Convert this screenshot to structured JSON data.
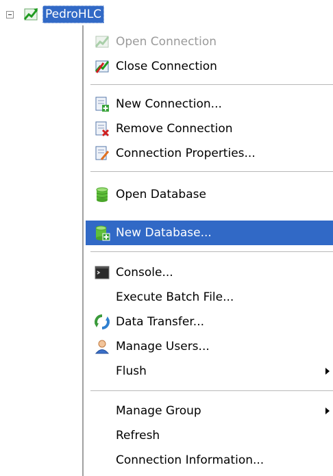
{
  "tree": {
    "node_label": "PedroHLC",
    "icons": {
      "expander": "collapse-minus",
      "connection": "connection-chart-icon"
    }
  },
  "menu": {
    "items": [
      {
        "label": "Open Connection",
        "icon": "open-connection-icon",
        "disabled": true
      },
      {
        "label": "Close Connection",
        "icon": "close-connection-icon"
      },
      {
        "label": "New Connection...",
        "icon": "new-connection-icon"
      },
      {
        "label": "Remove Connection",
        "icon": "remove-connection-icon"
      },
      {
        "label": "Connection Properties...",
        "icon": "connection-properties-icon"
      },
      {
        "label": "Open Database",
        "icon": "database-icon"
      },
      {
        "label": "New Database...",
        "icon": "new-database-icon",
        "selected": true
      },
      {
        "label": "Console...",
        "icon": "console-icon"
      },
      {
        "label": "Execute Batch File...",
        "icon": ""
      },
      {
        "label": "Data Transfer...",
        "icon": "data-transfer-icon"
      },
      {
        "label": "Manage Users...",
        "icon": "user-icon"
      },
      {
        "label": "Flush",
        "icon": "",
        "submenu": true
      },
      {
        "label": "Manage Group",
        "icon": "",
        "submenu": true
      },
      {
        "label": "Refresh",
        "icon": ""
      },
      {
        "label": "Connection Information...",
        "icon": ""
      }
    ],
    "submenu_arrow": "▶"
  },
  "colors": {
    "selection": "#3169c6",
    "disabled_text": "#9a9a9a"
  }
}
